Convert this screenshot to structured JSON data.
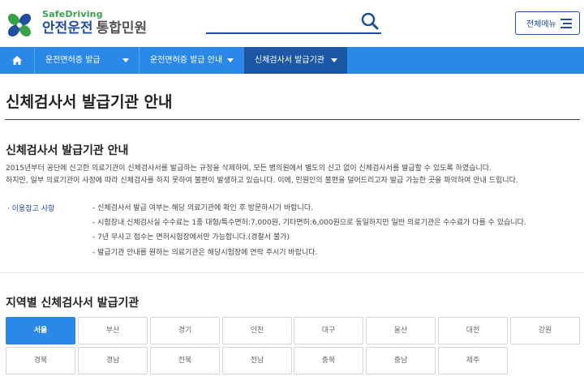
{
  "header": {
    "logo_en": "SafeDriving",
    "logo_ko": "안전운전",
    "logo_sub": "통합민원",
    "menu_label": "전체메뉴",
    "icons": [
      "clover-logo-icon",
      "search-icon",
      "hamburger-icon"
    ]
  },
  "nav": {
    "items": [
      {
        "label": "운전면허증 발급"
      },
      {
        "label": "운전면허증 발급 안내"
      },
      {
        "label": "신체검사서 발급기관",
        "active": true
      }
    ]
  },
  "main": {
    "page_title": "신체검사서 발급기관 안내",
    "section1_title": "신체검사서 발급기관 안내",
    "desc_lines": [
      "2015년부터 공단에 신고한 의료기관이 신체검사서를 발급하는 규정을 삭제하여, 모든 병의원에서 별도의 신고 없이 신체검사서를 발급할 수 있도록 하였습니다.",
      "하지만, 일부 의료기관이 사정에 따라 신체검사를 하지 못하여 불편이 발생하고 있습니다. 이에, 민원인의 불편을 덜어드리고자 발급 가능한 곳을 파악하여 안내 드립니다."
    ],
    "notice_label": "· 이용참고 사항",
    "notice_items": [
      "- 신체검사서 발급 여부는 해당 의료기관에 확인 후 방문하시기 바랍니다.",
      "- 시험장내 신체검사실 수수료는 1종 대형/특수면허:7,000원, 기타면허:6,000원으로 동일하지만 일반 의료기관은 수수료가 다를 수 있습니다.",
      "- 7년 무사고 접수는 면허시험장에서만 가능합니다.(경찰서 불가)",
      "- 발급기관 안내를 원하는 의료기관은 해당시험장에 연락 주시기 바랍니다."
    ],
    "section2_title": "지역별 신체검사서 발급기관",
    "regions": [
      "서울",
      "부산",
      "경기",
      "인천",
      "대구",
      "울산",
      "대전",
      "강원",
      "경북",
      "경남",
      "전북",
      "전남",
      "충북",
      "충남",
      "제주"
    ],
    "active_region": "서울"
  },
  "colors": {
    "nav_blue": "#2a88e8",
    "nav_active": "#1c57a6",
    "brand_blue": "#1f4f9e",
    "brand_green": "#3aa14a"
  }
}
